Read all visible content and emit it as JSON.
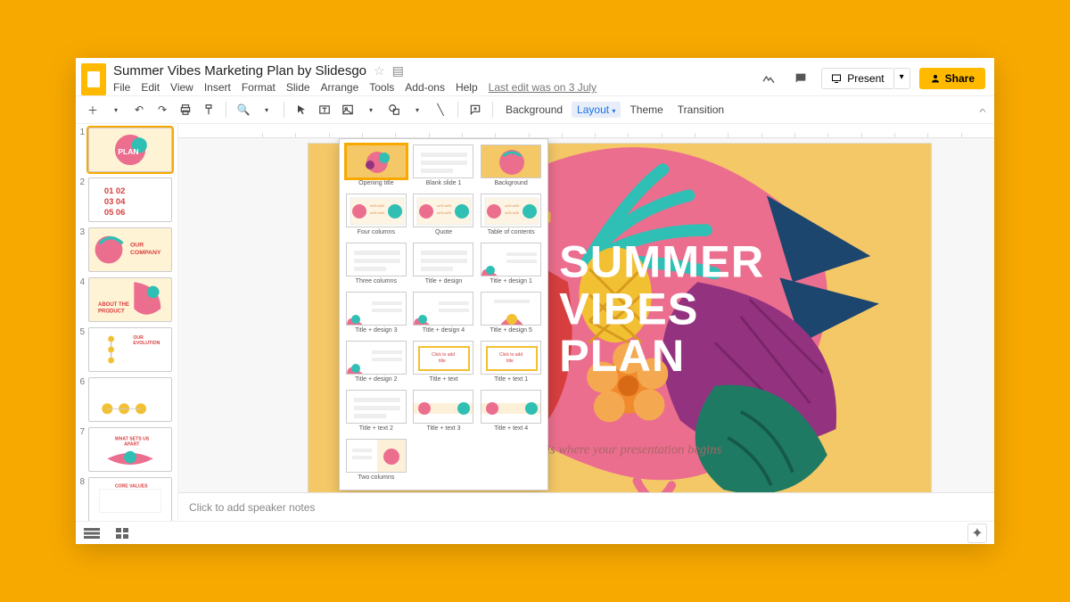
{
  "doc": {
    "title": "Summer Vibes Marketing Plan by Slidesgo",
    "last_edit": "Last edit was on 3 July"
  },
  "menu": {
    "file": "File",
    "edit": "Edit",
    "view": "View",
    "insert": "Insert",
    "format": "Format",
    "slide": "Slide",
    "arrange": "Arrange",
    "tools": "Tools",
    "addons": "Add-ons",
    "help": "Help"
  },
  "header_buttons": {
    "present": "Present",
    "share": "Share"
  },
  "toolbar": {
    "background": "Background",
    "layout": "Layout",
    "theme": "Theme",
    "transition": "Transition"
  },
  "slide": {
    "title_l1": "SUMMER",
    "title_l2": "VIBES",
    "title_l3": "PLAN",
    "subtitle": "Here is where your presentation begins"
  },
  "notes_placeholder": "Click to add speaker notes",
  "thumbs": [
    "1",
    "2",
    "3",
    "4",
    "5",
    "6",
    "7",
    "8"
  ],
  "layout_items": [
    {
      "label": "Opening title",
      "sel": true,
      "gold": true
    },
    {
      "label": "Blank slide 1"
    },
    {
      "label": "Background",
      "gold": true
    },
    {
      "label": "Four columns",
      "deco": true
    },
    {
      "label": "Quote",
      "deco": true
    },
    {
      "label": "Table of contents",
      "deco": true
    },
    {
      "label": "Three columns"
    },
    {
      "label": "Title + design"
    },
    {
      "label": "Title + design 1",
      "corner": true
    },
    {
      "label": "Title + design 3",
      "corner": true
    },
    {
      "label": "Title + design 4",
      "corner": true
    },
    {
      "label": "Title + design 5",
      "bottom": true
    },
    {
      "label": "Title + design 2",
      "corner": true
    },
    {
      "label": "Title + text",
      "box": true
    },
    {
      "label": "Title + text 1",
      "box": true
    },
    {
      "label": "Title + text 2"
    },
    {
      "label": "Title + text 3",
      "band": true
    },
    {
      "label": "Title + text 4",
      "band": true
    },
    {
      "label": "Two columns",
      "half": true
    }
  ]
}
